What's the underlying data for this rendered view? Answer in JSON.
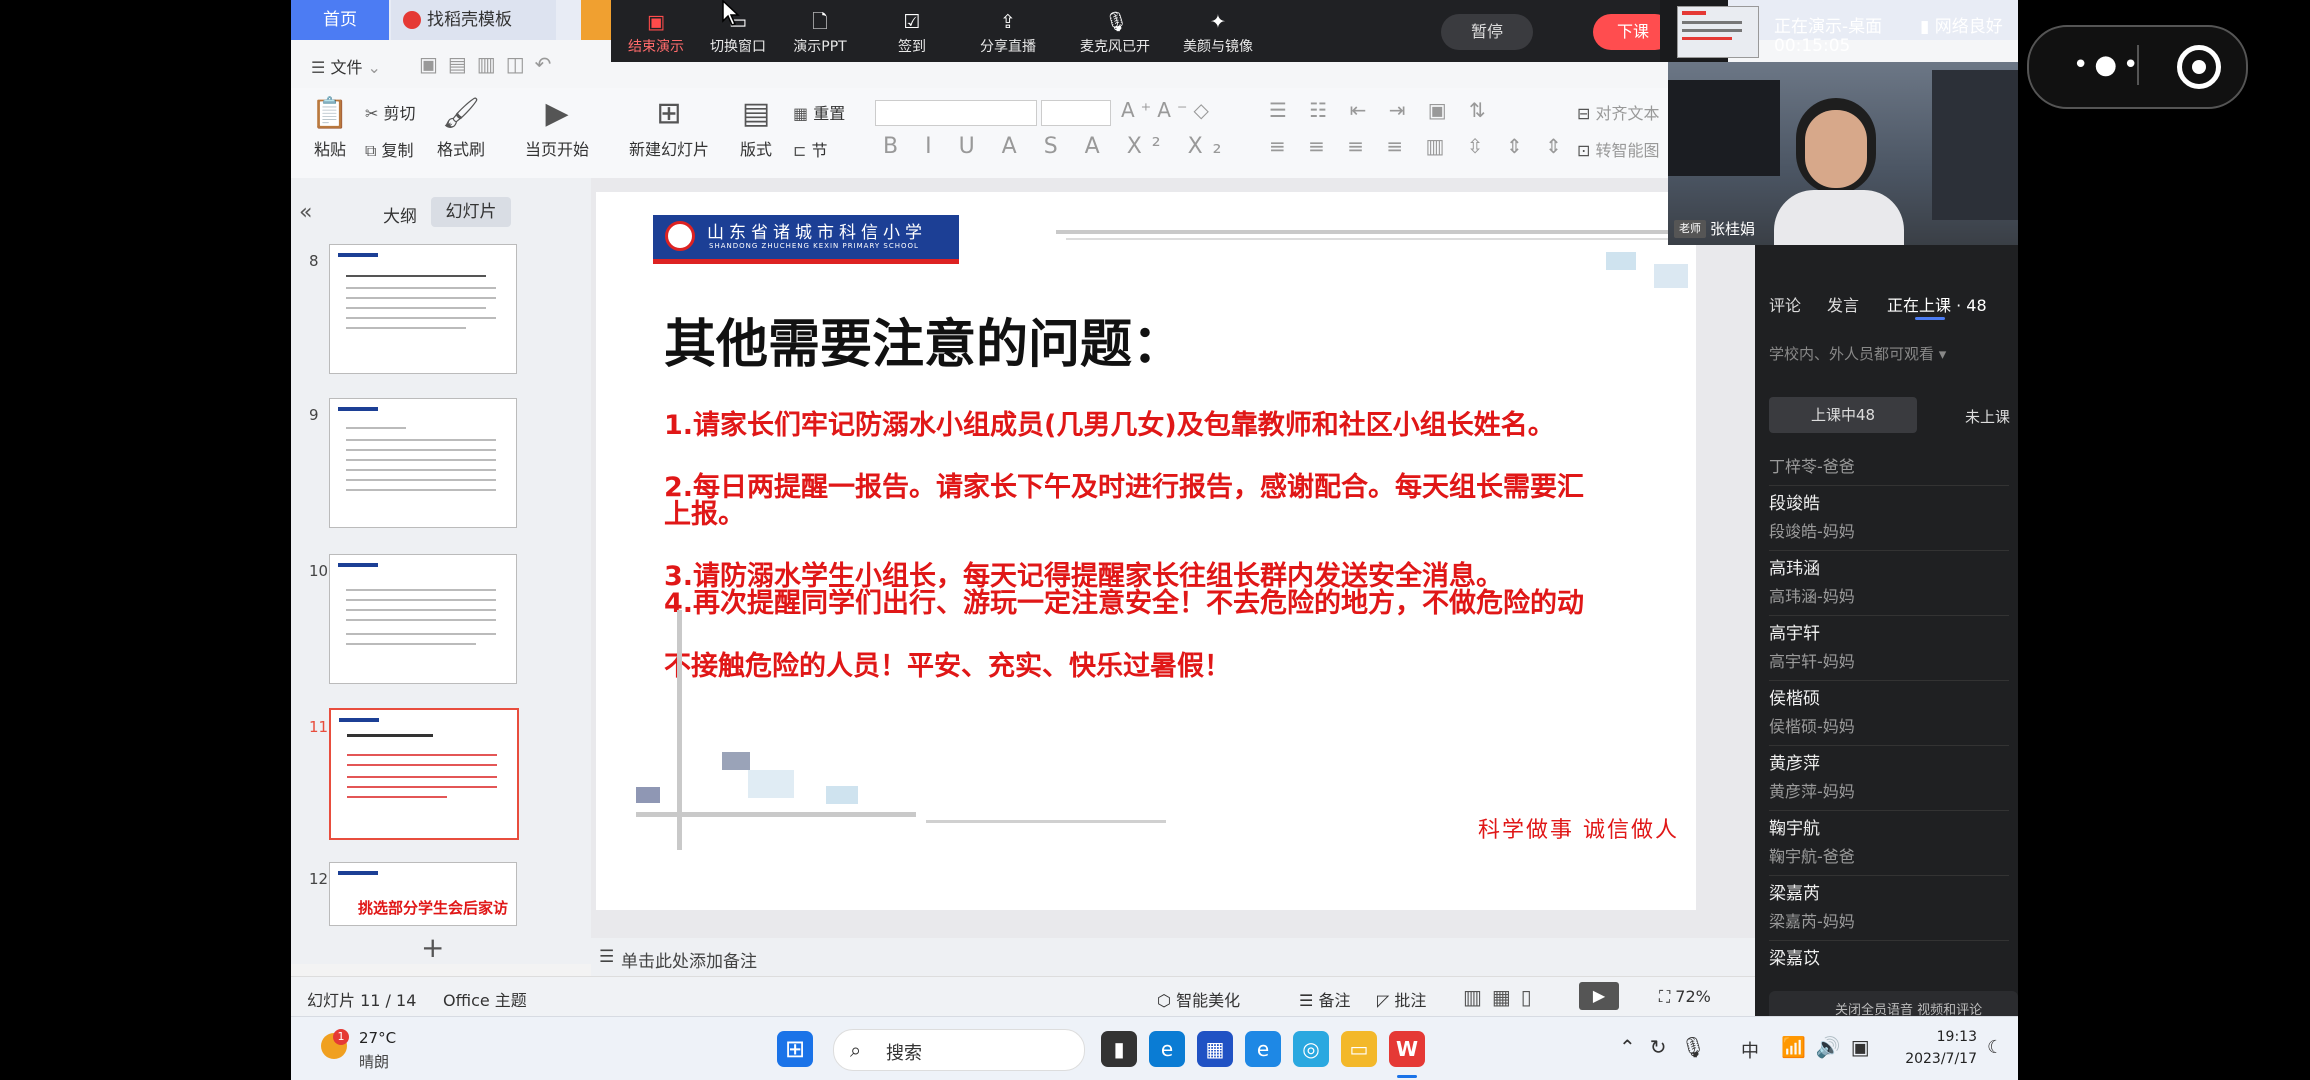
{
  "tabs": {
    "home": "首页",
    "template": "找稻壳模板"
  },
  "present_toolbar": {
    "items": [
      "结束演示",
      "切换窗口",
      "演示PPT",
      "签到",
      "分享直播",
      "麦克风已开",
      "美颜与镜像"
    ],
    "pause": "暂停",
    "end_class": "下课"
  },
  "live_status": {
    "state": "正在演示-桌面",
    "timer": "00:15:05",
    "network": "网络良好"
  },
  "menu": {
    "file": "文件"
  },
  "ribbon": {
    "paste": "粘贴",
    "cut": "剪切",
    "copy": "复制",
    "format_painter": "格式刷",
    "play_from_current": "当页开始",
    "new_slide": "新建幻灯片",
    "layout": "版式",
    "reset": "重置",
    "section": "节",
    "align_text": "对齐文本",
    "smart_graphic": "转智能图"
  },
  "left_panel": {
    "outline": "大纲",
    "slides": "幻灯片",
    "numbers": [
      "8",
      "9",
      "10",
      "11",
      "12"
    ],
    "thumb12_title": "挑选部分学生会后家访"
  },
  "slide": {
    "school": "山东省诸城市科信小学",
    "school_en": "SHANDONG ZHUCHENG KEXIN PRIMARY SCHOOL",
    "title": "其他需要注意的问题：",
    "lines": [
      "1.请家长们牢记防溺水小组成员(几男几女)及包靠教师和社区小组长姓名。",
      "2.每日两提醒一报告。请家长下午及时进行报告，感谢配合。每天组长需要汇",
      "上报。",
      "3.请防溺水学生小组长，每天记得提醒家长往组长群内发送安全消息。",
      "4.再次提醒同学们出行、游玩一定注意安全！不去危险的地方，不做危险的动",
      "不接触危险的人员！平安、充实、快乐过暑假！"
    ],
    "footer": "科学做事  诚信做人"
  },
  "notes": "单击此处添加备注",
  "status_bar": {
    "slide_count": "幻灯片 11 / 14",
    "theme": "Office 主题",
    "beautify": "智能美化",
    "notes": "备注",
    "comment": "批注",
    "zoom": "72%"
  },
  "taskbar": {
    "temp": "27°C",
    "weather": "晴朗",
    "weather_badge": "1",
    "search": "搜索",
    "ime": "中",
    "time": "19:13",
    "date": "2023/7/17"
  },
  "video": {
    "role": "老师",
    "name": "张桂娟"
  },
  "live_panel": {
    "tabs": [
      "评论",
      "发言",
      "正在上课 · 48"
    ],
    "visibility": "学校内、外人员都可观看",
    "sub_tabs": [
      "上课中48",
      "未上课"
    ],
    "students": [
      {
        "name": "",
        "parent": "丁梓苓-爸爸"
      },
      {
        "name": "段竣皓",
        "parent": "段竣皓-妈妈"
      },
      {
        "name": "高玮涵",
        "parent": "高玮涵-妈妈"
      },
      {
        "name": "高宇轩",
        "parent": "高宇轩-妈妈"
      },
      {
        "name": "侯楷硕",
        "parent": "侯楷硕-妈妈"
      },
      {
        "name": "黄彦萍",
        "parent": "黄彦萍-妈妈"
      },
      {
        "name": "鞠宇航",
        "parent": "鞠宇航-爸爸"
      },
      {
        "name": "梁嘉芮",
        "parent": "梁嘉芮-妈妈"
      },
      {
        "name": "梁嘉苡",
        "parent": ""
      }
    ],
    "footer": "关闭全员语音  视频和评论"
  }
}
